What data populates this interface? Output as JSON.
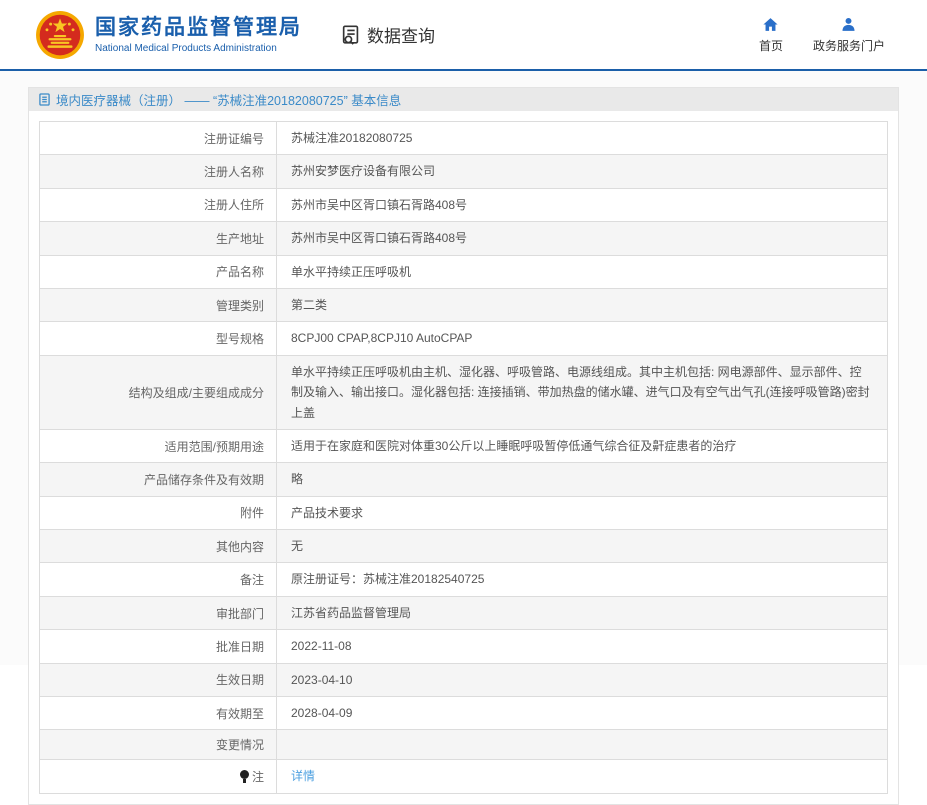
{
  "header": {
    "org_name_zh": "国家药品监督管理局",
    "org_name_en": "National Medical Products Administration",
    "query_label": "数据查询",
    "nav": [
      {
        "label": "首页",
        "icon": "home-icon"
      },
      {
        "label": "政务服务门户",
        "icon": "user-icon"
      }
    ]
  },
  "colors": {
    "brand_blue": "#1a5fac",
    "title_blue": "#3a8ac8",
    "link_blue": "#4da0e0",
    "emblem_red": "#d42b1e",
    "emblem_gold": "#f5a800",
    "row_stripe_gray": "#f5f5f5",
    "border_gray": "#dcdcdc"
  },
  "page": {
    "title": "境内医疗器械（注册） —— “苏械注准20182080725” 基本信息",
    "title_icon": "doc-icon"
  },
  "table": {
    "rows": [
      {
        "label": "注册证编号",
        "value": "苏械注准20182080725"
      },
      {
        "label": "注册人名称",
        "value": "苏州安梦医疗设备有限公司"
      },
      {
        "label": "注册人住所",
        "value": "苏州市吴中区胥口镇石胥路408号"
      },
      {
        "label": "生产地址",
        "value": "苏州市吴中区胥口镇石胥路408号"
      },
      {
        "label": "产品名称",
        "value": "单水平持续正压呼吸机"
      },
      {
        "label": "管理类别",
        "value": "第二类"
      },
      {
        "label": "型号规格",
        "value": "8CPJ00 CPAP,8CPJ10 AutoCPAP"
      },
      {
        "label": "结构及组成/主要组成成分",
        "value": "单水平持续正压呼吸机由主机、湿化器、呼吸管路、电源线组成。其中主机包括: 网电源部件、显示部件、控制及输入、输出接口。湿化器包括: 连接插销、带加热盘的储水罐、进气口及有空气出气孔(连接呼吸管路)密封上盖"
      },
      {
        "label": "适用范围/预期用途",
        "value": "适用于在家庭和医院对体重30公斤以上睡眠呼吸暂停低通气综合征及鼾症患者的治疗"
      },
      {
        "label": "产品储存条件及有效期",
        "value": "略"
      },
      {
        "label": "附件",
        "value": "产品技术要求"
      },
      {
        "label": "其他内容",
        "value": "无"
      },
      {
        "label": "备注",
        "value": "原注册证号：苏械注准20182540725"
      },
      {
        "label": "审批部门",
        "value": "江苏省药品监督管理局"
      },
      {
        "label": "批准日期",
        "value": "2022-11-08"
      },
      {
        "label": "生效日期",
        "value": "2023-04-10"
      },
      {
        "label": "有效期至",
        "value": "2028-04-09"
      },
      {
        "label": "变更情况",
        "value": ""
      },
      {
        "label": "注",
        "value": "详情",
        "link": true,
        "label_icon": "note-icon"
      }
    ]
  }
}
